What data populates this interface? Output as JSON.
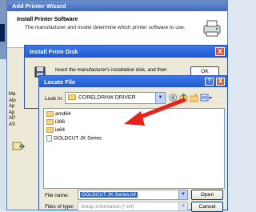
{
  "wizard": {
    "title": "Add Printer Wizard",
    "heading": "Install Printer Software",
    "subheading": "The manufacturer and model determine which printer software to use.",
    "manufacturer_list_fragments": [
      "Ma",
      "Alp",
      "Ap",
      "Ap",
      "AP",
      "AS"
    ]
  },
  "install_from_disk": {
    "title": "Install From Disk",
    "close_label": "X",
    "message": "Insert the manufacturer's installation disk, and then",
    "ok_label": "OK"
  },
  "locate_file": {
    "title": "Locate File",
    "help_label": "?",
    "close_label": "X",
    "look_in_label": "Look in:",
    "look_in_value": "CORELDRAW DRIVER",
    "toolbar_icons": [
      "back-icon",
      "up-folder-icon",
      "new-folder-icon",
      "view-menu-icon"
    ],
    "files": [
      {
        "name": "amd64",
        "type": "folder"
      },
      {
        "name": "i386",
        "type": "folder"
      },
      {
        "name": "ia64",
        "type": "folder"
      },
      {
        "name": "GOLDCUT JK Series",
        "type": "file"
      }
    ],
    "file_name_label": "File name:",
    "file_name_value": "GOLDCUT JK Series.inf",
    "files_of_type_label": "Files of type:",
    "files_of_type_value": "Setup Information (*.inf)",
    "open_label": "Open",
    "cancel_label": "Cancel"
  },
  "annotation": {
    "color": "#e8221b"
  }
}
